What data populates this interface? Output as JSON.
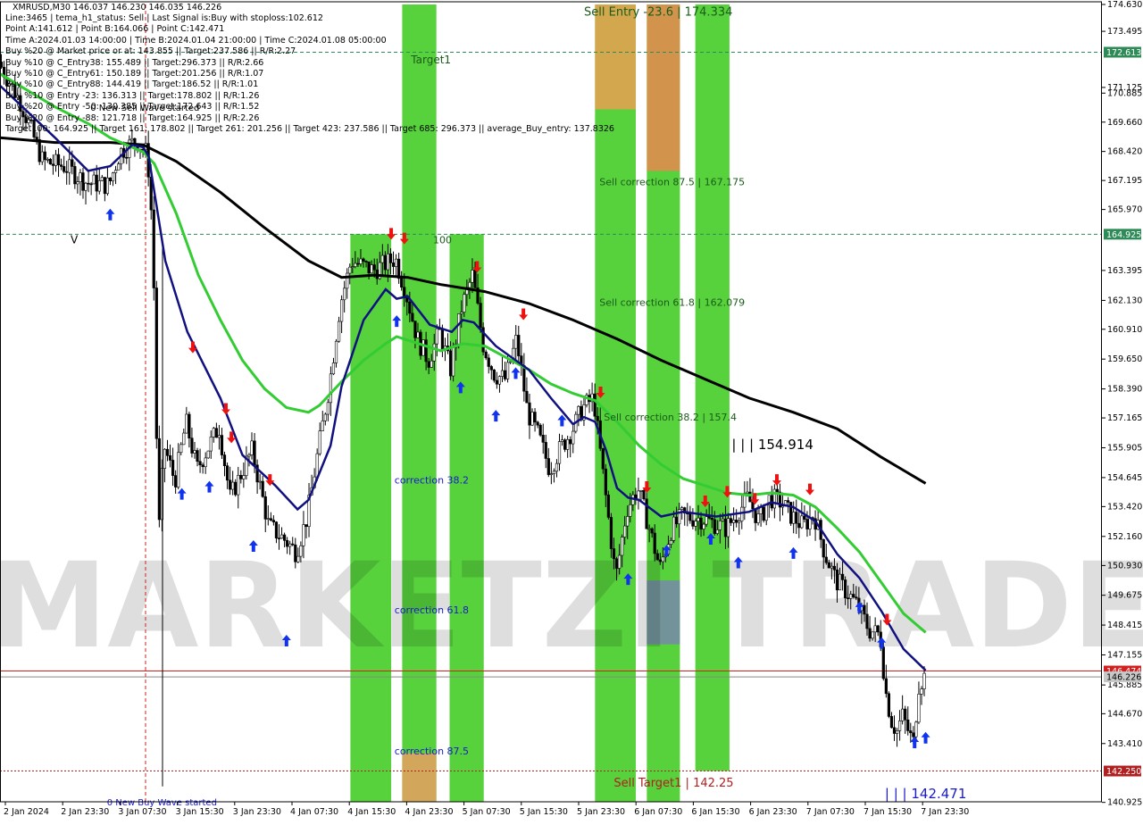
{
  "chart_data": {
    "type": "candlestick",
    "symbol_line": "XMRUSD,M30  146.037 146.230 146.035 146.226",
    "info_lines": [
      "Line:3465  |  tema_h1_status: Sell  |  Last Signal is:Buy with stoploss:102.612",
      "Point A:141.612  |  Point B:164.066  |  Point C:142.471",
      "Time A:2024.01.03 14:00:00  |  Time B:2024.01.04 21:00:00  |  Time C:2024.01.08 05:00:00",
      "Buy %20 @ Market price or at: 143.855  ||  Target:237.586  ||  R/R:2.27",
      "Buy %10 @ C_Entry38: 155.489  ||  Target:296.373  ||  R/R:2.66",
      "Buy %10 @ C_Entry61: 150.189  ||  Target:201.256  ||  R/R:1.07",
      "Buy %10 @ C_Entry88: 144.419  ||  Target:186.52  ||  R/R:1.01",
      "Buy %10 @ Entry -23: 136.313  ||  Target:178.802  ||  R/R:1.26",
      "Buy %20 @ Entry -50: 130.385  ||  Target:172.643  ||  R/R:1.52",
      "Buy %20 @ Entry -88: 121.718  ||  Target:164.925  ||  R/R:2.26",
      "Target100: 164.925  ||  Target 161: 178.802  ||  Target 261: 201.256  ||  Target 423: 237.586  ||  Target 685: 296.373  ||  average_Buy_entry: 137.8326"
    ],
    "price_axis": {
      "min": 140.95,
      "max": 174.63,
      "labels": [
        "174.630",
        "173.495",
        "172.613",
        "171.125",
        "170.885",
        "169.660",
        "168.420",
        "167.195",
        "165.970",
        "164.925",
        "163.395",
        "162.130",
        "160.910",
        "159.650",
        "158.390",
        "157.165",
        "155.905",
        "154.645",
        "153.420",
        "152.160",
        "150.930",
        "149.675",
        "148.415",
        "147.155",
        "145.885",
        "144.670",
        "143.410",
        "142.250",
        "140.925"
      ]
    },
    "price_ticks": [
      174.63,
      173.495,
      171.125,
      170.885,
      169.66,
      168.42,
      167.195,
      165.97,
      163.395,
      162.13,
      160.91,
      159.65,
      158.39,
      157.165,
      155.905,
      154.645,
      153.42,
      152.16,
      150.93,
      149.675,
      148.415,
      147.155,
      145.885,
      144.67,
      143.41,
      140.925
    ],
    "time_axis": [
      "2 Jan 2024",
      "2 Jan 23:30",
      "3 Jan 07:30",
      "3 Jan 15:30",
      "3 Jan 23:30",
      "4 Jan 07:30",
      "4 Jan 15:30",
      "4 Jan 23:30",
      "5 Jan 07:30",
      "5 Jan 15:30",
      "5 Jan 23:30",
      "6 Jan 07:30",
      "6 Jan 15:30",
      "6 Jan 23:30",
      "7 Jan 07:30",
      "7 Jan 15:30",
      "7 Jan 23:30"
    ],
    "levels": [
      {
        "name": "target-line",
        "price": 172.613,
        "label": "172.613",
        "color": "#2e8b57",
        "style": "dashed",
        "tag_bg": "#2e8b57"
      },
      {
        "name": "target100-line",
        "price": 164.925,
        "label": "164.925",
        "color": "#2e8b57",
        "style": "dashed",
        "tag_bg": "#2e8b57"
      },
      {
        "name": "stop-line",
        "price": 146.474,
        "label": "146.474",
        "color": "#d02020",
        "style": "solid",
        "tag_bg": "#d02020"
      },
      {
        "name": "current-price-line",
        "price": 146.226,
        "label": "146.226",
        "color": "#888888",
        "style": "solid",
        "tag_bg": "#c8c8c8"
      },
      {
        "name": "sell-target-line",
        "price": 142.25,
        "label": "142.250",
        "color": "#b02020",
        "style": "dotted",
        "tag_bg": "#b02020"
      }
    ],
    "zones": [
      {
        "x1": 0.318,
        "x2": 0.355,
        "top": 164.925,
        "bottom": 140.95,
        "color": "#3ac91a"
      },
      {
        "x1": 0.365,
        "x2": 0.396,
        "top": 174.63,
        "bottom": 140.95,
        "color": "#3ac91a"
      },
      {
        "x1": 0.365,
        "x2": 0.396,
        "top": 143.0,
        "bottom": 140.95,
        "color": "#e8a060"
      },
      {
        "x1": 0.408,
        "x2": 0.439,
        "top": 164.925,
        "bottom": 140.95,
        "color": "#3ac91a"
      },
      {
        "x1": 0.54,
        "x2": 0.577,
        "top": 174.63,
        "bottom": 140.95,
        "color": "#3ac91a"
      },
      {
        "x1": 0.54,
        "x2": 0.577,
        "top": 174.63,
        "bottom": 170.2,
        "color": "#e8a050"
      },
      {
        "x1": 0.587,
        "x2": 0.617,
        "top": 174.63,
        "bottom": 140.95,
        "color": "#3ac91a"
      },
      {
        "x1": 0.587,
        "x2": 0.617,
        "top": 174.63,
        "bottom": 167.6,
        "color": "#e88a50"
      },
      {
        "x1": 0.587,
        "x2": 0.617,
        "top": 150.3,
        "bottom": 147.6,
        "color": "#7788aa"
      },
      {
        "x1": 0.631,
        "x2": 0.662,
        "top": 174.63,
        "bottom": 142.25,
        "color": "#3ac91a"
      }
    ],
    "annotations": [
      {
        "text": "Sell Entry -23.6 | 174.334",
        "x": 0.53,
        "price": 174.15,
        "color": "#1a5c1a",
        "size": 13
      },
      {
        "text": "Target1",
        "x": 0.373,
        "price": 172.15,
        "color": "#1a5c1a",
        "size": 12
      },
      {
        "text": "Sell correction 87.5 | 167.175",
        "x": 0.544,
        "price": 167.0,
        "color": "#1a5c1a",
        "size": 11
      },
      {
        "text": "100",
        "x": 0.393,
        "price": 164.55,
        "color": "#1a5c1a",
        "size": 11
      },
      {
        "text": "Sell correction 61.8 | 162.079",
        "x": 0.544,
        "price": 161.9,
        "color": "#1a5c1a",
        "size": 11
      },
      {
        "text": "Sell correction 38.2 | 157.4",
        "x": 0.548,
        "price": 157.05,
        "color": "#1a5c1a",
        "size": 11
      },
      {
        "text": "| | | 154.914",
        "x": 0.664,
        "price": 155.85,
        "color": "#000000",
        "size": 15
      },
      {
        "text": "correction 38.2",
        "x": 0.358,
        "price": 154.4,
        "color": "#1a1acc",
        "size": 11
      },
      {
        "text": "correction 61.8",
        "x": 0.358,
        "price": 148.9,
        "color": "#1a1acc",
        "size": 11
      },
      {
        "text": "correction 87.5",
        "x": 0.358,
        "price": 142.95,
        "color": "#1a1acc",
        "size": 11
      },
      {
        "text": "Sell Target1 | 142.25",
        "x": 0.557,
        "price": 141.6,
        "color": "#b02020",
        "size": 13
      },
      {
        "text": "| | | 142.471",
        "x": 0.803,
        "price": 141.1,
        "color": "#1a1acc",
        "size": 15
      },
      {
        "text": "0 New Sell Wave started",
        "x": 0.082,
        "price": 170.15,
        "color": "#000000",
        "size": 10
      },
      {
        "text": "0 New Buy Wave started",
        "x": 0.097,
        "price": 140.8,
        "color": "#1a1acc",
        "size": 10
      },
      {
        "text": "V",
        "x": 0.064,
        "price": 164.55,
        "color": "#000000",
        "size": 12
      }
    ],
    "watermark": "MARKETZI TRADE",
    "price_path": [
      [
        0,
        172.2
      ],
      [
        0.02,
        170.5
      ],
      [
        0.04,
        168.0
      ],
      [
        0.06,
        167.8
      ],
      [
        0.08,
        167.1
      ],
      [
        0.1,
        167.0
      ],
      [
        0.11,
        168.4
      ],
      [
        0.125,
        168.9
      ],
      [
        0.135,
        168.3
      ],
      [
        0.14,
        164.8
      ],
      [
        0.145,
        152.0
      ],
      [
        0.15,
        156.0
      ],
      [
        0.16,
        154.5
      ],
      [
        0.17,
        157.0
      ],
      [
        0.18,
        155.0
      ],
      [
        0.2,
        156.8
      ],
      [
        0.21,
        153.8
      ],
      [
        0.23,
        155.8
      ],
      [
        0.245,
        152.6
      ],
      [
        0.26,
        152.0
      ],
      [
        0.27,
        151.5
      ],
      [
        0.28,
        153.0
      ],
      [
        0.29,
        155.8
      ],
      [
        0.3,
        158.5
      ],
      [
        0.31,
        162.0
      ],
      [
        0.32,
        163.8
      ],
      [
        0.34,
        163.4
      ],
      [
        0.36,
        163.9
      ],
      [
        0.37,
        162.4
      ],
      [
        0.38,
        160.5
      ],
      [
        0.39,
        159.6
      ],
      [
        0.4,
        160.8
      ],
      [
        0.41,
        159.2
      ],
      [
        0.42,
        161.8
      ],
      [
        0.43,
        163.2
      ],
      [
        0.44,
        160.2
      ],
      [
        0.45,
        159.0
      ],
      [
        0.46,
        158.8
      ],
      [
        0.47,
        160.5
      ],
      [
        0.48,
        157.4
      ],
      [
        0.49,
        156.4
      ],
      [
        0.5,
        155.0
      ],
      [
        0.51,
        155.9
      ],
      [
        0.52,
        156.6
      ],
      [
        0.53,
        157.6
      ],
      [
        0.54,
        158.0
      ],
      [
        0.55,
        154.2
      ],
      [
        0.56,
        150.4
      ],
      [
        0.57,
        153.3
      ],
      [
        0.58,
        154.2
      ],
      [
        0.59,
        152.6
      ],
      [
        0.6,
        150.8
      ],
      [
        0.61,
        152.4
      ],
      [
        0.62,
        153.0
      ],
      [
        0.64,
        152.9
      ],
      [
        0.66,
        152.5
      ],
      [
        0.67,
        153.1
      ],
      [
        0.68,
        153.8
      ],
      [
        0.69,
        152.8
      ],
      [
        0.7,
        153.8
      ],
      [
        0.71,
        153.6
      ],
      [
        0.72,
        153.0
      ],
      [
        0.73,
        152.6
      ],
      [
        0.74,
        153.1
      ],
      [
        0.75,
        151.4
      ],
      [
        0.76,
        150.3
      ],
      [
        0.77,
        149.8
      ],
      [
        0.78,
        149.2
      ],
      [
        0.79,
        148.2
      ],
      [
        0.8,
        148.0
      ],
      [
        0.805,
        145.6
      ],
      [
        0.81,
        144.4
      ],
      [
        0.815,
        143.9
      ],
      [
        0.82,
        144.6
      ],
      [
        0.83,
        143.4
      ],
      [
        0.835,
        145.9
      ],
      [
        0.84,
        146.23
      ]
    ],
    "ema_fast_path": [
      [
        0,
        171.2
      ],
      [
        0.05,
        169.0
      ],
      [
        0.08,
        167.6
      ],
      [
        0.1,
        167.8
      ],
      [
        0.12,
        168.7
      ],
      [
        0.13,
        168.6
      ],
      [
        0.135,
        168.2
      ],
      [
        0.15,
        163.8
      ],
      [
        0.17,
        160.8
      ],
      [
        0.2,
        158.0
      ],
      [
        0.22,
        155.6
      ],
      [
        0.25,
        154.3
      ],
      [
        0.27,
        153.3
      ],
      [
        0.28,
        153.7
      ],
      [
        0.3,
        156.0
      ],
      [
        0.31,
        158.5
      ],
      [
        0.33,
        161.3
      ],
      [
        0.35,
        162.6
      ],
      [
        0.36,
        162.2
      ],
      [
        0.37,
        162.3
      ],
      [
        0.39,
        161.1
      ],
      [
        0.41,
        160.8
      ],
      [
        0.42,
        161.3
      ],
      [
        0.43,
        161.2
      ],
      [
        0.45,
        160.2
      ],
      [
        0.48,
        159.2
      ],
      [
        0.5,
        158.0
      ],
      [
        0.52,
        156.9
      ],
      [
        0.53,
        157.2
      ],
      [
        0.54,
        157.0
      ],
      [
        0.55,
        155.8
      ],
      [
        0.56,
        154.2
      ],
      [
        0.57,
        153.8
      ],
      [
        0.58,
        153.7
      ],
      [
        0.6,
        153.0
      ],
      [
        0.62,
        153.2
      ],
      [
        0.65,
        153.0
      ],
      [
        0.68,
        153.2
      ],
      [
        0.7,
        153.6
      ],
      [
        0.72,
        153.4
      ],
      [
        0.74,
        152.8
      ],
      [
        0.76,
        151.4
      ],
      [
        0.78,
        150.4
      ],
      [
        0.8,
        149.0
      ],
      [
        0.82,
        147.4
      ],
      [
        0.84,
        146.5
      ]
    ],
    "ema_slow_path": [
      [
        0,
        171.7
      ],
      [
        0.05,
        170.3
      ],
      [
        0.08,
        169.6
      ],
      [
        0.1,
        169.0
      ],
      [
        0.13,
        168.4
      ],
      [
        0.14,
        167.9
      ],
      [
        0.16,
        165.8
      ],
      [
        0.18,
        163.2
      ],
      [
        0.2,
        161.3
      ],
      [
        0.22,
        159.6
      ],
      [
        0.24,
        158.4
      ],
      [
        0.26,
        157.6
      ],
      [
        0.28,
        157.4
      ],
      [
        0.29,
        157.7
      ],
      [
        0.31,
        158.7
      ],
      [
        0.33,
        159.6
      ],
      [
        0.35,
        160.3
      ],
      [
        0.36,
        160.6
      ],
      [
        0.38,
        160.3
      ],
      [
        0.4,
        160.0
      ],
      [
        0.42,
        160.3
      ],
      [
        0.44,
        160.2
      ],
      [
        0.46,
        159.7
      ],
      [
        0.48,
        159.2
      ],
      [
        0.5,
        158.6
      ],
      [
        0.52,
        158.2
      ],
      [
        0.54,
        157.9
      ],
      [
        0.56,
        157.0
      ],
      [
        0.58,
        156.0
      ],
      [
        0.6,
        155.2
      ],
      [
        0.62,
        154.6
      ],
      [
        0.64,
        154.3
      ],
      [
        0.66,
        154.0
      ],
      [
        0.68,
        153.9
      ],
      [
        0.7,
        154.0
      ],
      [
        0.72,
        153.9
      ],
      [
        0.74,
        153.4
      ],
      [
        0.76,
        152.5
      ],
      [
        0.78,
        151.5
      ],
      [
        0.8,
        150.2
      ],
      [
        0.82,
        148.9
      ],
      [
        0.84,
        148.1
      ]
    ],
    "ema_long_path": [
      [
        0,
        169.0
      ],
      [
        0.05,
        168.8
      ],
      [
        0.1,
        168.8
      ],
      [
        0.13,
        168.7
      ],
      [
        0.16,
        168.0
      ],
      [
        0.2,
        166.7
      ],
      [
        0.24,
        165.2
      ],
      [
        0.28,
        163.8
      ],
      [
        0.31,
        163.1
      ],
      [
        0.34,
        163.2
      ],
      [
        0.37,
        163.1
      ],
      [
        0.4,
        162.8
      ],
      [
        0.44,
        162.5
      ],
      [
        0.48,
        162.0
      ],
      [
        0.52,
        161.3
      ],
      [
        0.56,
        160.5
      ],
      [
        0.6,
        159.6
      ],
      [
        0.64,
        158.8
      ],
      [
        0.68,
        158.0
      ],
      [
        0.72,
        157.4
      ],
      [
        0.76,
        156.7
      ],
      [
        0.8,
        155.5
      ],
      [
        0.84,
        154.4
      ]
    ],
    "buy_signals": [
      [
        0.1,
        165.7
      ],
      [
        0.165,
        153.9
      ],
      [
        0.19,
        154.2
      ],
      [
        0.23,
        151.7
      ],
      [
        0.26,
        147.7
      ],
      [
        0.36,
        161.2
      ],
      [
        0.418,
        158.4
      ],
      [
        0.45,
        157.2
      ],
      [
        0.468,
        159.0
      ],
      [
        0.51,
        157.0
      ],
      [
        0.57,
        150.3
      ],
      [
        0.605,
        151.5
      ],
      [
        0.645,
        152.0
      ],
      [
        0.67,
        151.0
      ],
      [
        0.72,
        151.4
      ],
      [
        0.78,
        149.1
      ],
      [
        0.8,
        147.6
      ],
      [
        0.83,
        143.4
      ],
      [
        0.84,
        143.6
      ]
    ],
    "sell_signals": [
      [
        0.175,
        160.2
      ],
      [
        0.205,
        157.6
      ],
      [
        0.21,
        156.4
      ],
      [
        0.245,
        154.6
      ],
      [
        0.355,
        165.0
      ],
      [
        0.367,
        164.8
      ],
      [
        0.433,
        163.6
      ],
      [
        0.475,
        161.6
      ],
      [
        0.545,
        158.3
      ],
      [
        0.587,
        154.3
      ],
      [
        0.64,
        153.7
      ],
      [
        0.66,
        154.1
      ],
      [
        0.685,
        153.8
      ],
      [
        0.705,
        154.6
      ],
      [
        0.735,
        154.2
      ],
      [
        0.805,
        148.7
      ]
    ],
    "series": [
      {
        "name": "tema_h1"
      }
    ]
  }
}
